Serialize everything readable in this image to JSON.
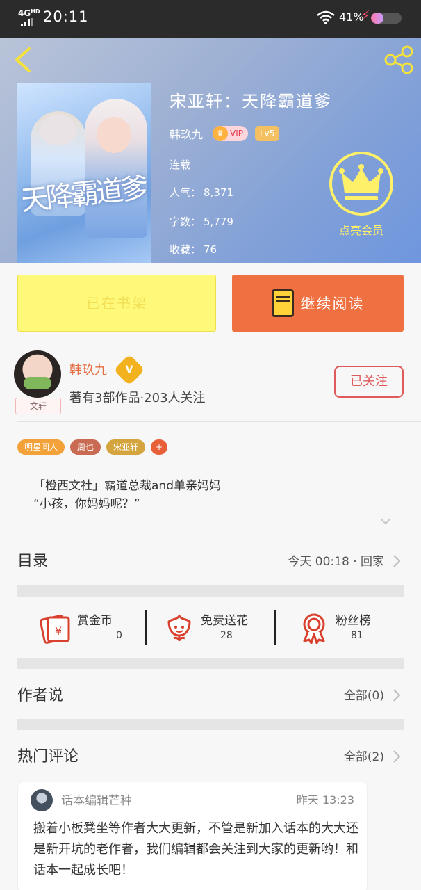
{
  "status_bar": {
    "network": "4G",
    "network_sup": "HD",
    "time": "20:11",
    "battery_text": "41%",
    "battery_level": 0.41
  },
  "book": {
    "cover_title": "天降霸道爹",
    "title": "宋亚轩：天降霸道爹",
    "author": "韩玖九",
    "vip_label": "VIP",
    "level_label": "Lv5",
    "status": "连载",
    "popularity_label": "人气：",
    "popularity_value": "8,371",
    "word_count_label": "字数：",
    "word_count_value": "5,779",
    "favorites_label": "收藏：",
    "favorites_value": "76",
    "member_label": "点亮会员"
  },
  "actions": {
    "in_shelf_label": "已在书架",
    "continue_label": "继续阅读"
  },
  "author_block": {
    "name": "韩玖九",
    "verified_badge": "V",
    "avatar_tag": "文轩",
    "stats": "著有3部作品·203人关注",
    "follow_label": "已关注"
  },
  "tags": [
    {
      "label": "明星同人",
      "color": "#f2a238"
    },
    {
      "label": "周也",
      "color": "#c96a52"
    },
    {
      "label": "宋亚轩",
      "color": "#d4a43e"
    },
    {
      "label": "+",
      "color": "#e8603a"
    }
  ],
  "intro": {
    "line1": "「橙西文社」霸道总裁and单亲妈妈",
    "line2": "“小孩，你妈妈呢？”"
  },
  "toc": {
    "label": "目录",
    "latest": "今天 00:18 · 回家"
  },
  "rewards": [
    {
      "title": "赏金币",
      "value": "0",
      "icon": "gold-coin-red-envelope-icon"
    },
    {
      "title": "免费送花",
      "value": "28",
      "icon": "flower-icon"
    },
    {
      "title": "粉丝榜",
      "value": "81",
      "icon": "ribbon-badge-icon"
    }
  ],
  "author_says": {
    "label": "作者说",
    "right": "全部(0)"
  },
  "hot_comments": {
    "label": "热门评论",
    "right": "全部(2)"
  },
  "comment": {
    "name": "话本编辑芒种",
    "time": "昨天 13:23",
    "text": "搬着小板凳坐等作者大大更新，不管是新加入话本的大大还是新开坑的老作者，我们编辑都会关注到大家的更新哟！和话本一起成长吧！"
  },
  "colors": {
    "accent_orange": "#ef7040",
    "shelf_yellow": "#fff97a",
    "follow_red": "#df5a5a",
    "author_orange": "#e36e43"
  }
}
